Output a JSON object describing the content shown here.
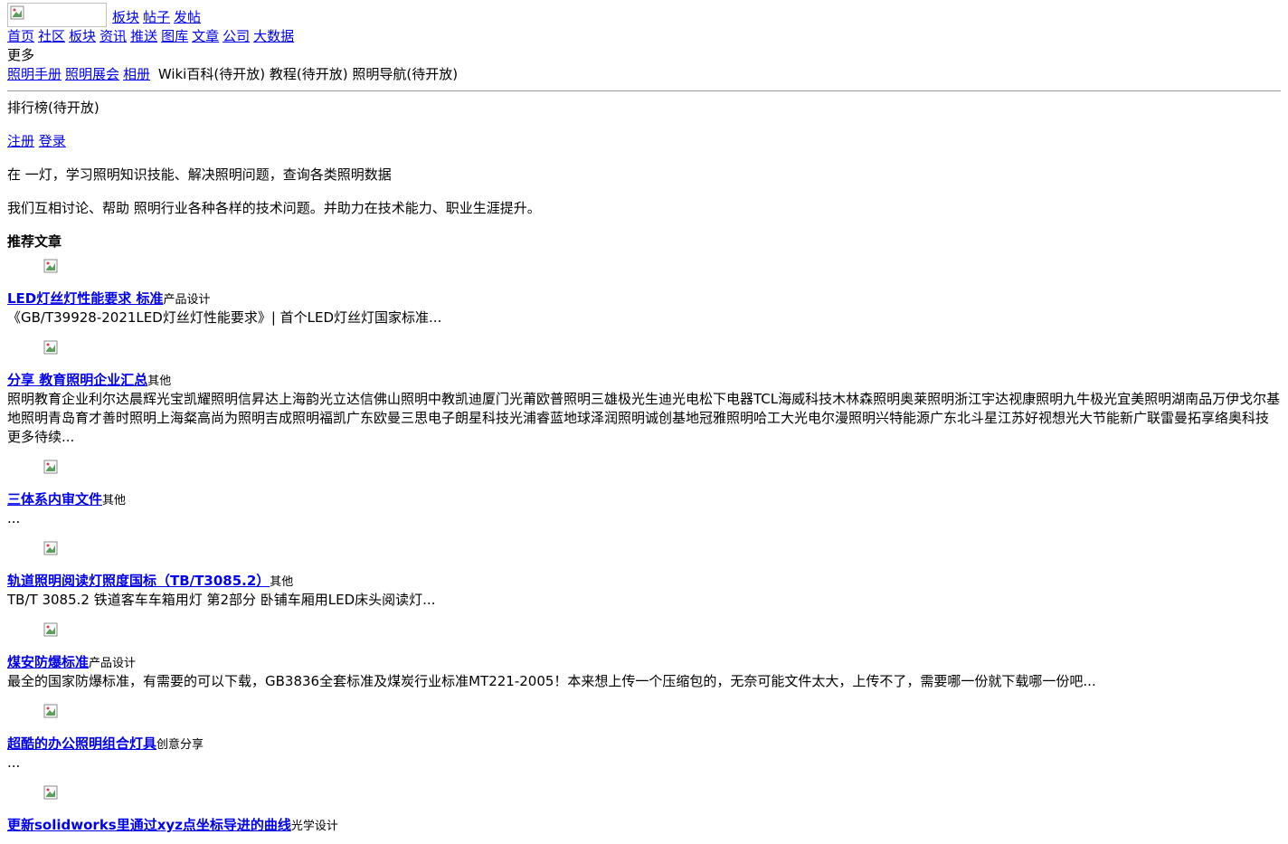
{
  "header": {
    "top_links": [
      "板块",
      "帖子",
      "发帖"
    ],
    "nav": [
      "首页",
      "社区",
      "板块",
      "资讯",
      "推送",
      "图库",
      "文章",
      "公司",
      "大数据"
    ],
    "more_label": "更多",
    "more_links": [
      "照明手册",
      "照明展会",
      "相册"
    ],
    "more_static": [
      "Wiki百科(待开放)",
      "教程(待开放)",
      "照明导航(待开放)"
    ]
  },
  "ranking_label": "排行榜(待开放)",
  "auth": {
    "register": "注册",
    "login": "登录"
  },
  "intro": {
    "line1": "在 一灯，学习照明知识技能、解决照明问题，查询各类照明数据",
    "line2": "我们互相讨论、帮助 照明行业各种各样的技术问题。并助力在技术能力、职业生涯提升。"
  },
  "recommend_title": "推荐文章",
  "articles": [
    {
      "title": "LED灯丝灯性能要求 标准",
      "category": "产品设计",
      "desc": "《GB/T39928-2021LED灯丝灯性能要求》| 首个LED灯丝灯国家标准..."
    },
    {
      "title": "分享 教育照明企业汇总",
      "category": "其他",
      "desc": "照明教育企业利尔达晨辉光宝凯耀照明信昇达上海韵光立达信佛山照明中教凯迪厦门光莆欧普照明三雄极光生迪光电松下电器TCL海威科技木林森照明奥莱照明浙江宇达视康照明九牛极光宜美照明湖南品万伊戈尔基地照明青岛育才善时照明上海粲高尚为照明吉成照明福凯广东欧曼三思电子朗星科技光浦睿蓝地球泽润照明诚创基地冠雅照明哈工大光电尔漫照明兴特能源广东北斗星江苏好视想光大节能新广联雷曼拓享络奥科技更多待续..."
    },
    {
      "title": "三体系内审文件",
      "category": "其他",
      "desc": "..."
    },
    {
      "title": "轨道照明阅读灯照度国标（TB/T3085.2）",
      "category": "其他",
      "desc": "TB/T 3085.2 铁道客车车箱用灯 第2部分 卧铺车厢用LED床头阅读灯..."
    },
    {
      "title": "煤安防爆标准",
      "category": "产品设计",
      "desc": "最全的国家防爆标准，有需要的可以下载，GB3836全套标准及煤炭行业标准MT221-2005！本来想上传一个压缩包的，无奈可能文件太大，上传不了，需要哪一份就下载哪一份吧..."
    },
    {
      "title": "超酷的办公照明组合灯具",
      "category": "创意分享",
      "desc": "..."
    },
    {
      "title": "更新solidworks里通过xyz点坐标导进的曲线",
      "category": "光学设计",
      "desc": ""
    }
  ]
}
